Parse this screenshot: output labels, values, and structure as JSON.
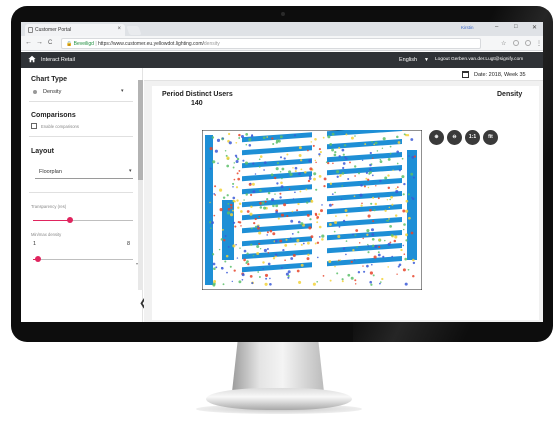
{
  "browser": {
    "tab_title": "Customer Portal",
    "tab_close": "×",
    "profile": "Kirstin",
    "secure_label": "Beveiligd",
    "url": "https://www.customer.eu.yellowdot.lighting.com/",
    "url_path": "density",
    "nav_back": "←",
    "nav_forward": "→",
    "nav_reload": "C",
    "win_min": "–",
    "win_max": "□",
    "win_close": "✕",
    "star_icon": "☆",
    "menu_icon": "⋮"
  },
  "app": {
    "title": "Interact Retail",
    "language": "English",
    "language_caret": "▼",
    "logout": "Logout Gerben.van.der.Lugt@signify.com"
  },
  "sidebar": {
    "chart_type_title": "Chart Type",
    "chart_type_value": "Density",
    "comparisons_title": "Comparisons",
    "enable_comparisons": "Enable comparisons",
    "layout_title": "Layout",
    "layout_value": "Floorplan",
    "transparency_label": "Transparency (res)",
    "min_density_label": "Min/max density",
    "min_density_min": "1",
    "min_density_max": "8",
    "caret": "▾",
    "collapse": "❮",
    "transparency_level": 0.37,
    "density_level": 0.05
  },
  "main": {
    "date": "Date: 2018, Week 35",
    "card_title": "Period Distinct Users",
    "count": "140",
    "mode": "Density",
    "zoom_buttons": [
      "⊕",
      "⊖",
      "1:1",
      "fit"
    ]
  },
  "colors": {
    "header_bg": "#2f3236",
    "accent": "#e0245e",
    "shelf_blue": "#1e8fd6",
    "heat_red": "#e8442a",
    "heat_yellow": "#f2d23a",
    "heat_green": "#5cc06a"
  }
}
